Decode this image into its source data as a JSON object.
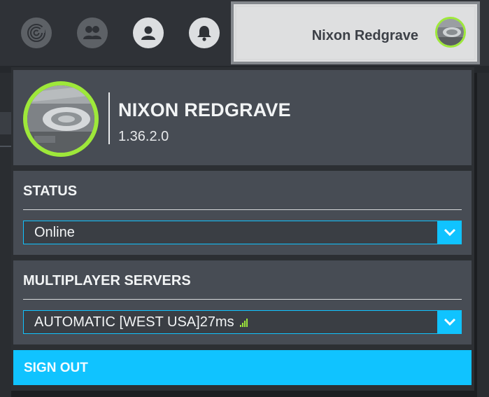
{
  "nav": {
    "icons": [
      "radar-icon",
      "friends-icon",
      "profile-icon",
      "notifications-icon"
    ]
  },
  "user_chip": {
    "name": "Nixon Redgrave"
  },
  "profile": {
    "name": "NIXON REDGRAVE",
    "version": "1.36.2.0"
  },
  "status": {
    "title": "STATUS",
    "selected": "Online"
  },
  "servers": {
    "title": "MULTIPLAYER SERVERS",
    "selected": "AUTOMATIC [WEST USA]27ms"
  },
  "signout": {
    "label": "SIGN OUT"
  },
  "colors": {
    "accent": "#10c3ff",
    "avatar_ring": "#9ee83a",
    "card": "#474c54",
    "signal": "#9ee83a"
  }
}
